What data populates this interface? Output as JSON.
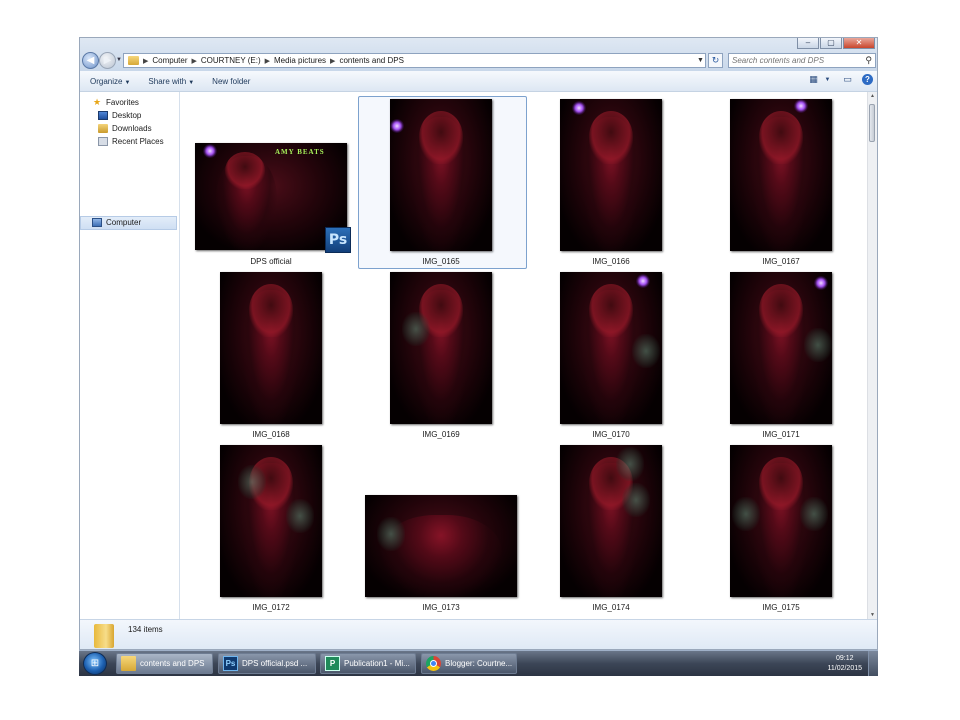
{
  "window": {
    "caption_buttons": {
      "minimize": "–",
      "maximize": "▢",
      "close": "✕"
    }
  },
  "address": {
    "crumbs": [
      "Computer",
      "COURTNEY (E:)",
      "Media pictures",
      "contents and DPS"
    ]
  },
  "search": {
    "placeholder": "Search contents and DPS"
  },
  "toolbar": {
    "organize": "Organize",
    "share_with": "Share with",
    "new_folder": "New folder"
  },
  "nav": {
    "favorites": "Favorites",
    "desktop": "Desktop",
    "downloads": "Downloads",
    "recent_places": "Recent Places",
    "computer": "Computer"
  },
  "files": [
    {
      "name": "DPS official",
      "type": "psd",
      "overlay_text": "AMY BEATS",
      "badge": "Ps"
    },
    {
      "name": "IMG_0165",
      "selected": true
    },
    {
      "name": "IMG_0166"
    },
    {
      "name": "IMG_0167"
    },
    {
      "name": "IMG_0168"
    },
    {
      "name": "IMG_0169"
    },
    {
      "name": "IMG_0170"
    },
    {
      "name": "IMG_0171"
    },
    {
      "name": "IMG_0172"
    },
    {
      "name": "IMG_0173"
    },
    {
      "name": "IMG_0174"
    },
    {
      "name": "IMG_0175"
    }
  ],
  "status": {
    "item_count": "134 items"
  },
  "taskbar": {
    "buttons": [
      {
        "label": "contents and DPS",
        "icon": "folder-icon",
        "active": true
      },
      {
        "label": "DPS official.psd ...",
        "icon": "photoshop-icon",
        "app_glyph": "Ps"
      },
      {
        "label": "Publication1 - Mi...",
        "icon": "publisher-icon",
        "app_glyph": "P"
      },
      {
        "label": "Blogger: Courtne...",
        "icon": "chrome-icon"
      }
    ],
    "time": "09:12",
    "date": "11/02/2015"
  },
  "colors": {
    "chrome_blue": "#dfe8f3",
    "taskbar": "#3c4657",
    "selection_border": "#7da2ce"
  }
}
